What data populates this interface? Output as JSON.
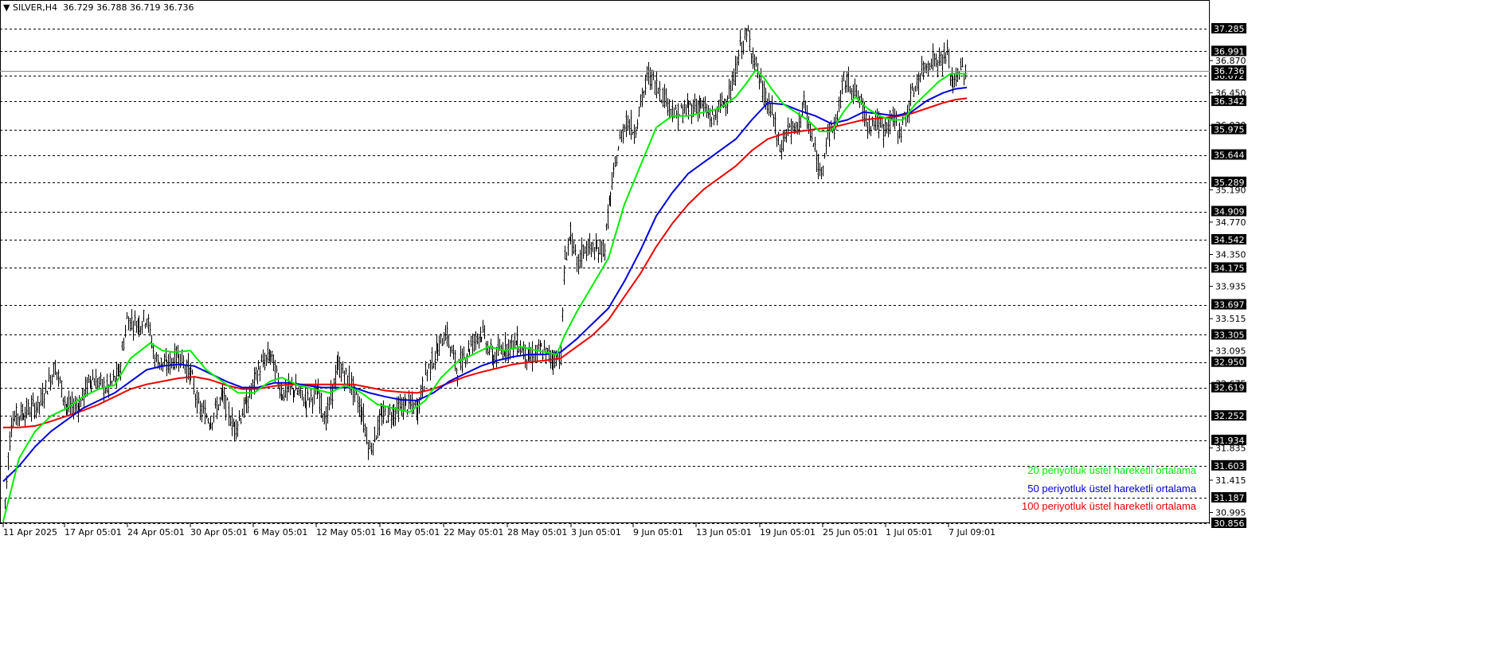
{
  "header": {
    "arrow": "▼",
    "symbol": "SILVER,H4",
    "ohlc": "36.729 36.788 36.719 36.736"
  },
  "legend": [
    {
      "text": "20 periyotluk üstel hareketli ortalama",
      "color": "#00ee00"
    },
    {
      "text": "50 periyotluk üstel hareketli ortalama",
      "color": "#0000dd"
    },
    {
      "text": "100 periyotluk üstel hareketli ortalama",
      "color": "#ee0000"
    }
  ],
  "chart_data": {
    "type": "candlestick",
    "title": "SILVER,H4",
    "ylim": [
      30.856,
      37.45
    ],
    "y_ticks": [
      "36.870",
      "36.450",
      "36.030",
      "35.190",
      "34.770",
      "34.350",
      "33.935",
      "33.515",
      "33.095",
      "32.675",
      "31.835",
      "31.415",
      "30.995"
    ],
    "level_lines": [
      "37.285",
      "36.991",
      "36.672",
      "36.342",
      "35.975",
      "35.644",
      "35.289",
      "34.909",
      "34.542",
      "34.175",
      "33.697",
      "33.305",
      "32.950",
      "32.619",
      "32.252",
      "31.934",
      "31.603",
      "31.187",
      "30.856"
    ],
    "current_price_tag": "36.736",
    "x_labels": [
      "11 Apr 2025",
      "17 Apr 05:01",
      "24 Apr 05:01",
      "30 Apr 05:01",
      "6 May 05:01",
      "12 May 05:01",
      "16 May 05:01",
      "22 May 05:01",
      "28 May 05:01",
      "3 Jun 05:01",
      "9 Jun 05:01",
      "13 Jun 05:01",
      "19 Jun 05:01",
      "25 Jun 05:01",
      "1 Jul 05:01",
      "7 Jul 09:01"
    ],
    "close_series": [
      {
        "x": 0,
        "y": 30.9
      },
      {
        "x": 10,
        "y": 32.2
      },
      {
        "x": 25,
        "y": 32.3
      },
      {
        "x": 45,
        "y": 32.4
      },
      {
        "x": 65,
        "y": 32.9
      },
      {
        "x": 80,
        "y": 32.35
      },
      {
        "x": 95,
        "y": 32.4
      },
      {
        "x": 110,
        "y": 32.75
      },
      {
        "x": 130,
        "y": 32.6
      },
      {
        "x": 145,
        "y": 32.8
      },
      {
        "x": 155,
        "y": 33.5
      },
      {
        "x": 170,
        "y": 33.45
      },
      {
        "x": 180,
        "y": 33.55
      },
      {
        "x": 190,
        "y": 33.0
      },
      {
        "x": 205,
        "y": 32.9
      },
      {
        "x": 220,
        "y": 33.05
      },
      {
        "x": 235,
        "y": 32.8
      },
      {
        "x": 245,
        "y": 32.35
      },
      {
        "x": 260,
        "y": 32.2
      },
      {
        "x": 275,
        "y": 32.5
      },
      {
        "x": 290,
        "y": 32.1
      },
      {
        "x": 305,
        "y": 32.4
      },
      {
        "x": 320,
        "y": 32.85
      },
      {
        "x": 335,
        "y": 33.05
      },
      {
        "x": 350,
        "y": 32.55
      },
      {
        "x": 365,
        "y": 32.6
      },
      {
        "x": 380,
        "y": 32.45
      },
      {
        "x": 395,
        "y": 32.55
      },
      {
        "x": 405,
        "y": 32.2
      },
      {
        "x": 420,
        "y": 32.9
      },
      {
        "x": 435,
        "y": 32.7
      },
      {
        "x": 450,
        "y": 32.3
      },
      {
        "x": 460,
        "y": 31.8
      },
      {
        "x": 475,
        "y": 32.25
      },
      {
        "x": 490,
        "y": 32.3
      },
      {
        "x": 505,
        "y": 32.4
      },
      {
        "x": 520,
        "y": 32.35
      },
      {
        "x": 530,
        "y": 32.8
      },
      {
        "x": 545,
        "y": 33.1
      },
      {
        "x": 555,
        "y": 33.35
      },
      {
        "x": 570,
        "y": 32.85
      },
      {
        "x": 585,
        "y": 33.15
      },
      {
        "x": 600,
        "y": 33.35
      },
      {
        "x": 615,
        "y": 33.0
      },
      {
        "x": 630,
        "y": 33.15
      },
      {
        "x": 645,
        "y": 33.2
      },
      {
        "x": 660,
        "y": 33.0
      },
      {
        "x": 675,
        "y": 33.1
      },
      {
        "x": 690,
        "y": 33.0
      },
      {
        "x": 700,
        "y": 33.05
      },
      {
        "x": 705,
        "y": 34.3
      },
      {
        "x": 712,
        "y": 34.6
      },
      {
        "x": 720,
        "y": 34.2
      },
      {
        "x": 730,
        "y": 34.45
      },
      {
        "x": 745,
        "y": 34.4
      },
      {
        "x": 755,
        "y": 34.45
      },
      {
        "x": 762,
        "y": 35.1
      },
      {
        "x": 772,
        "y": 35.75
      },
      {
        "x": 782,
        "y": 36.1
      },
      {
        "x": 792,
        "y": 35.95
      },
      {
        "x": 800,
        "y": 36.3
      },
      {
        "x": 810,
        "y": 36.7
      },
      {
        "x": 820,
        "y": 36.55
      },
      {
        "x": 830,
        "y": 36.4
      },
      {
        "x": 845,
        "y": 36.15
      },
      {
        "x": 860,
        "y": 36.25
      },
      {
        "x": 875,
        "y": 36.3
      },
      {
        "x": 890,
        "y": 36.1
      },
      {
        "x": 905,
        "y": 36.35
      },
      {
        "x": 915,
        "y": 36.5
      },
      {
        "x": 925,
        "y": 37.05
      },
      {
        "x": 935,
        "y": 37.2
      },
      {
        "x": 945,
        "y": 36.8
      },
      {
        "x": 955,
        "y": 36.4
      },
      {
        "x": 965,
        "y": 36.2
      },
      {
        "x": 975,
        "y": 35.7
      },
      {
        "x": 985,
        "y": 36.0
      },
      {
        "x": 995,
        "y": 35.95
      },
      {
        "x": 1005,
        "y": 36.3
      },
      {
        "x": 1015,
        "y": 35.85
      },
      {
        "x": 1025,
        "y": 35.4
      },
      {
        "x": 1035,
        "y": 35.9
      },
      {
        "x": 1045,
        "y": 36.05
      },
      {
        "x": 1055,
        "y": 36.6
      },
      {
        "x": 1065,
        "y": 36.55
      },
      {
        "x": 1075,
        "y": 36.35
      },
      {
        "x": 1085,
        "y": 36.05
      },
      {
        "x": 1095,
        "y": 36.1
      },
      {
        "x": 1105,
        "y": 35.95
      },
      {
        "x": 1115,
        "y": 36.15
      },
      {
        "x": 1125,
        "y": 35.95
      },
      {
        "x": 1135,
        "y": 36.2
      },
      {
        "x": 1145,
        "y": 36.55
      },
      {
        "x": 1155,
        "y": 36.75
      },
      {
        "x": 1165,
        "y": 36.9
      },
      {
        "x": 1175,
        "y": 36.85
      },
      {
        "x": 1185,
        "y": 36.95
      },
      {
        "x": 1192,
        "y": 36.55
      },
      {
        "x": 1200,
        "y": 36.75
      },
      {
        "x": 1210,
        "y": 36.74
      }
    ],
    "ema20": [
      [
        0,
        30.88
      ],
      [
        20,
        31.7
      ],
      [
        40,
        32.05
      ],
      [
        60,
        32.25
      ],
      [
        80,
        32.35
      ],
      [
        100,
        32.5
      ],
      [
        120,
        32.6
      ],
      [
        140,
        32.65
      ],
      [
        160,
        33.0
      ],
      [
        185,
        33.2
      ],
      [
        200,
        33.1
      ],
      [
        215,
        33.08
      ],
      [
        235,
        33.1
      ],
      [
        255,
        32.85
      ],
      [
        275,
        32.7
      ],
      [
        295,
        32.55
      ],
      [
        315,
        32.55
      ],
      [
        335,
        32.7
      ],
      [
        350,
        32.75
      ],
      [
        370,
        32.65
      ],
      [
        390,
        32.6
      ],
      [
        410,
        32.55
      ],
      [
        430,
        32.65
      ],
      [
        450,
        32.55
      ],
      [
        470,
        32.4
      ],
      [
        490,
        32.35
      ],
      [
        510,
        32.3
      ],
      [
        530,
        32.45
      ],
      [
        550,
        32.75
      ],
      [
        570,
        32.95
      ],
      [
        590,
        33.05
      ],
      [
        610,
        33.15
      ],
      [
        630,
        33.1
      ],
      [
        650,
        33.15
      ],
      [
        670,
        33.1
      ],
      [
        695,
        33.05
      ],
      [
        705,
        33.3
      ],
      [
        720,
        33.6
      ],
      [
        740,
        33.95
      ],
      [
        760,
        34.3
      ],
      [
        780,
        35.0
      ],
      [
        800,
        35.5
      ],
      [
        820,
        36.0
      ],
      [
        840,
        36.15
      ],
      [
        860,
        36.15
      ],
      [
        880,
        36.2
      ],
      [
        900,
        36.25
      ],
      [
        920,
        36.4
      ],
      [
        935,
        36.6
      ],
      [
        945,
        36.75
      ],
      [
        955,
        36.65
      ],
      [
        965,
        36.5
      ],
      [
        980,
        36.3
      ],
      [
        995,
        36.2
      ],
      [
        1010,
        36.1
      ],
      [
        1025,
        35.95
      ],
      [
        1040,
        35.95
      ],
      [
        1055,
        36.2
      ],
      [
        1070,
        36.4
      ],
      [
        1085,
        36.25
      ],
      [
        1100,
        36.15
      ],
      [
        1115,
        36.1
      ],
      [
        1130,
        36.1
      ],
      [
        1145,
        36.3
      ],
      [
        1160,
        36.45
      ],
      [
        1175,
        36.6
      ],
      [
        1190,
        36.7
      ],
      [
        1210,
        36.7
      ]
    ],
    "ema50": [
      [
        0,
        31.4
      ],
      [
        20,
        31.6
      ],
      [
        40,
        31.85
      ],
      [
        60,
        32.05
      ],
      [
        80,
        32.2
      ],
      [
        100,
        32.35
      ],
      [
        120,
        32.45
      ],
      [
        140,
        32.55
      ],
      [
        160,
        32.7
      ],
      [
        180,
        32.85
      ],
      [
        200,
        32.9
      ],
      [
        220,
        32.92
      ],
      [
        240,
        32.9
      ],
      [
        260,
        32.8
      ],
      [
        280,
        32.7
      ],
      [
        300,
        32.62
      ],
      [
        320,
        32.62
      ],
      [
        340,
        32.68
      ],
      [
        360,
        32.68
      ],
      [
        380,
        32.65
      ],
      [
        400,
        32.62
      ],
      [
        420,
        32.62
      ],
      [
        440,
        32.62
      ],
      [
        460,
        32.55
      ],
      [
        480,
        32.5
      ],
      [
        500,
        32.46
      ],
      [
        520,
        32.45
      ],
      [
        540,
        32.55
      ],
      [
        560,
        32.7
      ],
      [
        580,
        32.8
      ],
      [
        600,
        32.9
      ],
      [
        620,
        32.97
      ],
      [
        640,
        33.02
      ],
      [
        660,
        33.05
      ],
      [
        680,
        33.05
      ],
      [
        700,
        33.08
      ],
      [
        720,
        33.25
      ],
      [
        740,
        33.45
      ],
      [
        760,
        33.65
      ],
      [
        780,
        34.0
      ],
      [
        800,
        34.4
      ],
      [
        820,
        34.85
      ],
      [
        840,
        35.15
      ],
      [
        860,
        35.4
      ],
      [
        880,
        35.55
      ],
      [
        900,
        35.7
      ],
      [
        920,
        35.85
      ],
      [
        940,
        36.1
      ],
      [
        960,
        36.32
      ],
      [
        980,
        36.3
      ],
      [
        1000,
        36.22
      ],
      [
        1020,
        36.15
      ],
      [
        1040,
        36.05
      ],
      [
        1060,
        36.1
      ],
      [
        1080,
        36.2
      ],
      [
        1100,
        36.18
      ],
      [
        1120,
        36.15
      ],
      [
        1140,
        36.2
      ],
      [
        1160,
        36.35
      ],
      [
        1180,
        36.45
      ],
      [
        1195,
        36.5
      ],
      [
        1210,
        36.52
      ]
    ],
    "ema100": [
      [
        0,
        32.1
      ],
      [
        20,
        32.1
      ],
      [
        40,
        32.12
      ],
      [
        60,
        32.18
      ],
      [
        80,
        32.25
      ],
      [
        100,
        32.32
      ],
      [
        120,
        32.4
      ],
      [
        140,
        32.5
      ],
      [
        160,
        32.6
      ],
      [
        180,
        32.66
      ],
      [
        200,
        32.7
      ],
      [
        220,
        32.74
      ],
      [
        240,
        32.76
      ],
      [
        260,
        32.72
      ],
      [
        280,
        32.65
      ],
      [
        300,
        32.6
      ],
      [
        320,
        32.6
      ],
      [
        340,
        32.64
      ],
      [
        360,
        32.66
      ],
      [
        380,
        32.66
      ],
      [
        400,
        32.66
      ],
      [
        420,
        32.66
      ],
      [
        440,
        32.66
      ],
      [
        460,
        32.62
      ],
      [
        480,
        32.58
      ],
      [
        500,
        32.56
      ],
      [
        520,
        32.55
      ],
      [
        540,
        32.6
      ],
      [
        560,
        32.68
      ],
      [
        580,
        32.76
      ],
      [
        600,
        32.82
      ],
      [
        620,
        32.87
      ],
      [
        640,
        32.92
      ],
      [
        660,
        32.95
      ],
      [
        680,
        32.97
      ],
      [
        700,
        33.0
      ],
      [
        720,
        33.15
      ],
      [
        740,
        33.3
      ],
      [
        760,
        33.5
      ],
      [
        780,
        33.8
      ],
      [
        800,
        34.1
      ],
      [
        820,
        34.45
      ],
      [
        840,
        34.75
      ],
      [
        860,
        35.0
      ],
      [
        880,
        35.2
      ],
      [
        900,
        35.35
      ],
      [
        920,
        35.5
      ],
      [
        940,
        35.7
      ],
      [
        960,
        35.85
      ],
      [
        980,
        35.92
      ],
      [
        1000,
        35.95
      ],
      [
        1020,
        35.98
      ],
      [
        1040,
        36.0
      ],
      [
        1060,
        36.05
      ],
      [
        1080,
        36.1
      ],
      [
        1100,
        36.12
      ],
      [
        1120,
        36.14
      ],
      [
        1140,
        36.18
      ],
      [
        1160,
        36.25
      ],
      [
        1180,
        36.32
      ],
      [
        1195,
        36.36
      ],
      [
        1210,
        36.38
      ]
    ]
  }
}
